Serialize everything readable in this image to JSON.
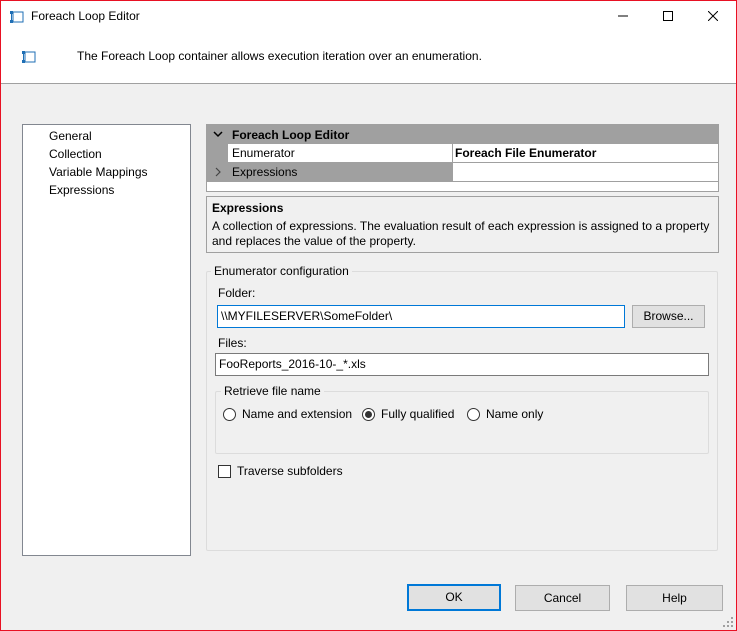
{
  "window": {
    "title": "Foreach Loop Editor",
    "header_text": "The Foreach Loop container allows execution iteration over an enumeration."
  },
  "nav": {
    "items": [
      {
        "label": "General"
      },
      {
        "label": "Collection"
      },
      {
        "label": "Variable Mappings"
      },
      {
        "label": "Expressions"
      }
    ],
    "selected": "Collection"
  },
  "grid": {
    "category": "Foreach Loop Editor",
    "rows": [
      {
        "name": "Enumerator",
        "value": "Foreach File Enumerator"
      },
      {
        "name": "Expressions",
        "value": ""
      }
    ]
  },
  "description": {
    "title": "Expressions",
    "text": "A collection of expressions. The evaluation result of each expression is assigned to a property and replaces the value of the property."
  },
  "enumerator_config": {
    "group_label": "Enumerator configuration",
    "folder_label": "Folder:",
    "folder_value": "\\\\MYFILESERVER\\SomeFolder\\",
    "browse_label": "Browse...",
    "files_label": "Files:",
    "files_value": "FooReports_2016-10-_*.xls",
    "retrieve_label": "Retrieve file name",
    "options": [
      {
        "label": "Name and extension",
        "selected": false
      },
      {
        "label": "Fully qualified",
        "selected": true
      },
      {
        "label": "Name only",
        "selected": false
      }
    ],
    "traverse_label": "Traverse subfolders",
    "traverse_checked": false
  },
  "buttons": {
    "ok": "OK",
    "cancel": "Cancel",
    "help": "Help"
  },
  "colors": {
    "window_border": "#e81123",
    "focus_blue": "#0078d7",
    "grid_gray": "#a0a0a0"
  }
}
